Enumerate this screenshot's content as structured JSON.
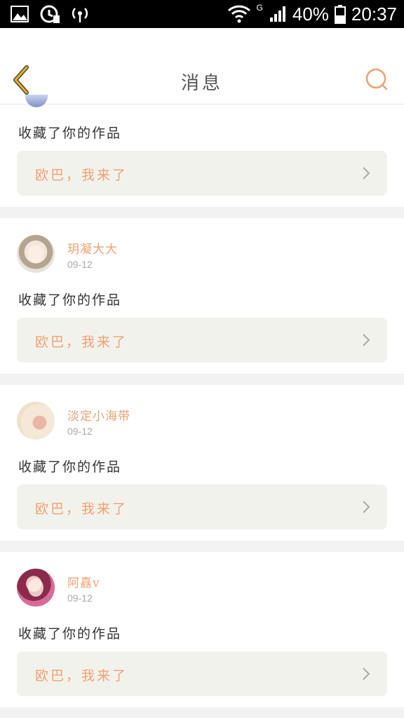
{
  "status_bar": {
    "battery": "40%",
    "time": "20:37",
    "network_type": "G",
    "icons": [
      "gallery-icon",
      "sync-icon",
      "hotspot-icon",
      "wifi-icon",
      "signal-icon",
      "battery-icon"
    ]
  },
  "header": {
    "title": "消息",
    "back_icon": "chevron-left-icon",
    "search_icon": "search-icon"
  },
  "colors": {
    "accent": "#f0a070",
    "back_arrow": "#e8b020",
    "quote_bg": "#f2f2ec",
    "divider": "#f2f2f2"
  },
  "notifications": [
    {
      "user": "",
      "date": "",
      "action": "收藏了你的作品",
      "quote": "欧巴，我来了"
    },
    {
      "user": "玥凝大大",
      "date": "09-12",
      "action": "收藏了你的作品",
      "quote": "欧巴，我来了"
    },
    {
      "user": "淡定小海带",
      "date": "09-12",
      "action": "收藏了你的作品",
      "quote": "欧巴，我来了"
    },
    {
      "user": "阿嚞v",
      "date": "09-12",
      "action": "收藏了你的作品",
      "quote": "欧巴，我来了"
    }
  ]
}
